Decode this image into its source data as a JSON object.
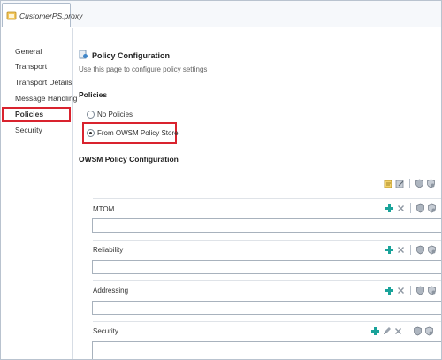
{
  "editor_tab": {
    "title": "CustomerPS.proxy",
    "icon": "proxy-service-icon"
  },
  "nav": {
    "items": [
      {
        "label": "General"
      },
      {
        "label": "Transport"
      },
      {
        "label": "Transport Details"
      },
      {
        "label": "Message Handling"
      },
      {
        "label": "Policies",
        "selected": true
      },
      {
        "label": "Security"
      }
    ]
  },
  "header": {
    "title": "Policy Configuration",
    "subtitle": "Use this page to configure policy settings",
    "icon": "policy-config-icon"
  },
  "policies": {
    "title": "Policies",
    "options": [
      {
        "label": "No Policies",
        "checked": false
      },
      {
        "label": "From OWSM Policy Store",
        "checked": true
      }
    ]
  },
  "owsm": {
    "title": "OWSM Policy Configuration",
    "toolbar_icons": [
      "attach-policy-icon",
      "edit-policy-icon",
      "validate-icon",
      "override-icon"
    ],
    "rows": [
      {
        "label": "MTOM",
        "value": "",
        "actions": [
          "add-icon",
          "remove-icon",
          "validate-icon",
          "override-icon"
        ]
      },
      {
        "label": "Reliability",
        "value": "",
        "actions": [
          "add-icon",
          "remove-icon",
          "validate-icon",
          "override-icon"
        ]
      },
      {
        "label": "Addressing",
        "value": "",
        "actions": [
          "add-icon",
          "remove-icon",
          "validate-icon",
          "override-icon"
        ]
      },
      {
        "label": "Security",
        "value": "",
        "actions": [
          "add-icon",
          "edit-icon",
          "remove-icon",
          "validate-icon",
          "override-icon"
        ]
      }
    ]
  },
  "colors": {
    "highlight": "#d9232e",
    "add": "#1aa39a",
    "border": "#a8b2bd"
  }
}
